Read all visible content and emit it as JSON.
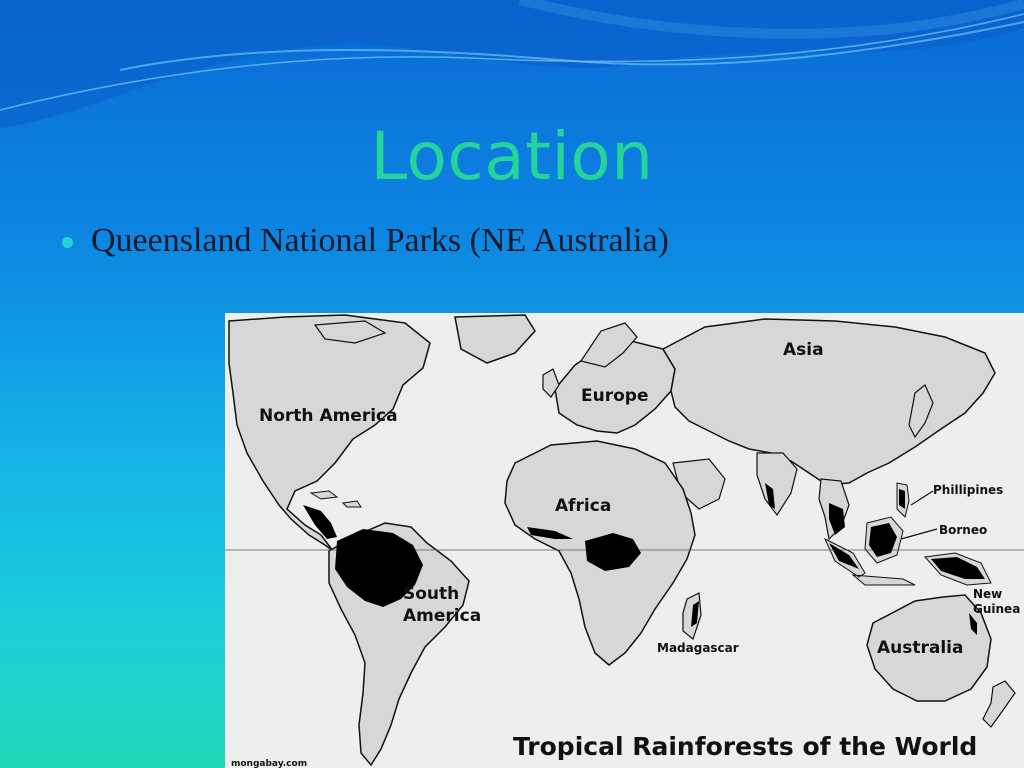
{
  "slide": {
    "title": "Location",
    "bullets": [
      "Queensland National Parks (NE Australia)"
    ]
  },
  "map": {
    "title": "Tropical Rainforests of the World",
    "source": "mongabay.com",
    "labels": {
      "north_america": "North America",
      "europe": "Europe",
      "asia": "Asia",
      "africa": "Africa",
      "south_america": "South America",
      "madagascar": "Madagascar",
      "australia": "Australia",
      "phillipines": "Phillipines",
      "borneo": "Borneo",
      "new_guinea": "New Guinea"
    }
  },
  "colors": {
    "title": "#24d49a",
    "bullet_dot": "#22d3d3",
    "land": "#d7d7d7",
    "rainforest": "#000000",
    "ocean": "#eeeeee"
  }
}
